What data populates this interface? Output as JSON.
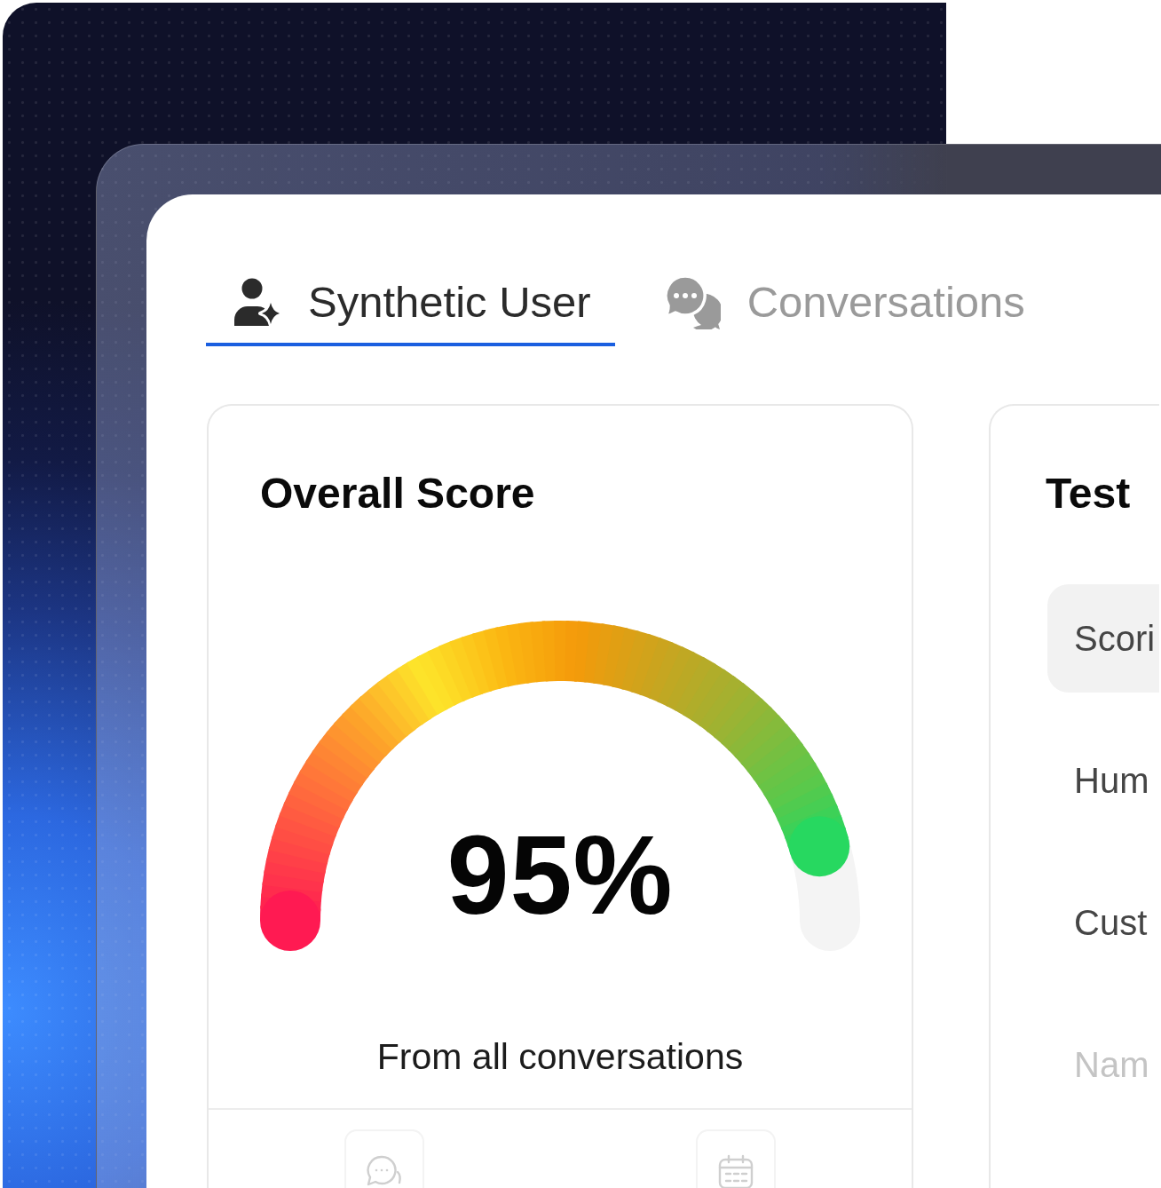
{
  "tabs": [
    {
      "label": "Synthetic User",
      "selected": true
    },
    {
      "label": "Conversations",
      "selected": false
    }
  ],
  "score_card": {
    "title": "Overall Score",
    "gauge": {
      "level": 0.95
    },
    "value": "95%",
    "caption": "From all conversations"
  },
  "results_card": {
    "title": "Test",
    "items": [
      {
        "label": "Scori",
        "selected": true,
        "faded": false
      },
      {
        "label": "Hum",
        "selected": false,
        "faded": false
      },
      {
        "label": "Cust",
        "selected": false,
        "faded": false
      },
      {
        "label": "Nam",
        "selected": false,
        "faded": true
      }
    ]
  }
}
